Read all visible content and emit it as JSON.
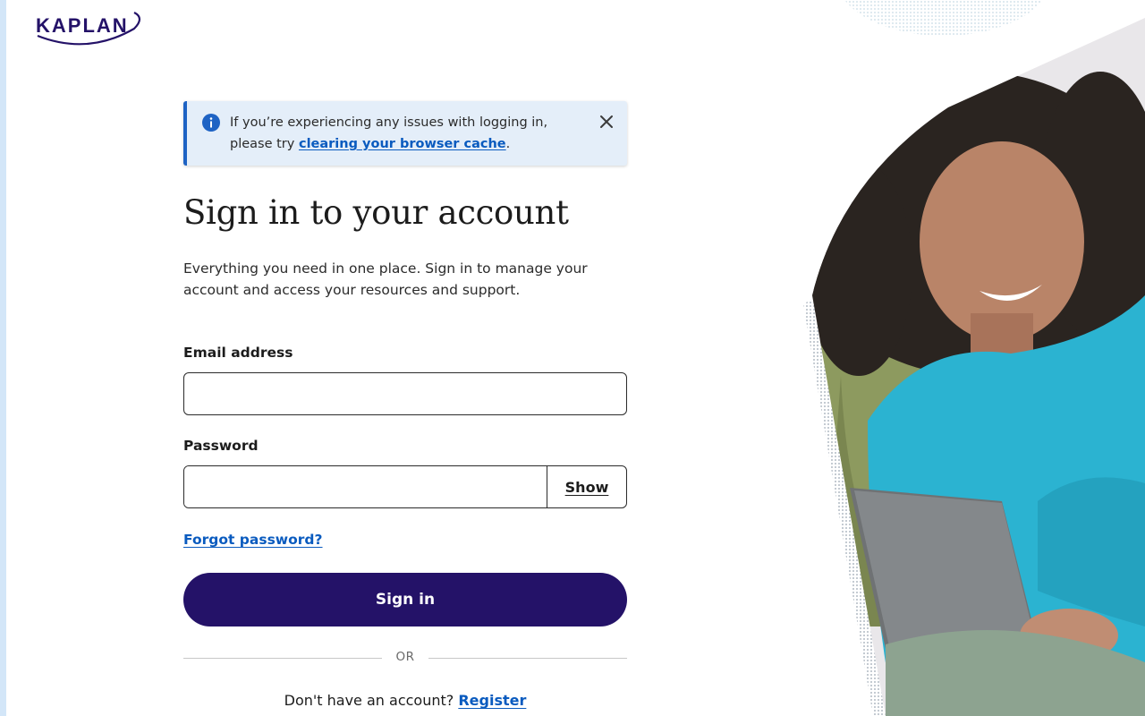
{
  "brand": {
    "logo_text": "KAPLAN"
  },
  "alert": {
    "text_before": "If you’re experiencing any issues with logging in, please try ",
    "link_text": "clearing your browser cache",
    "text_after": ".",
    "icon": "info-icon",
    "close_icon": "close-icon"
  },
  "page": {
    "title": "Sign in to your account",
    "subtitle": "Everything you need in one place. Sign in to manage your account and access your resources and support."
  },
  "form": {
    "email_label": "Email address",
    "email_value": "",
    "password_label": "Password",
    "password_value": "",
    "show_label": "Show",
    "forgot_label": "Forgot password?",
    "submit_label": "Sign in",
    "divider_label": "OR",
    "register_prompt": "Don't have an account? ",
    "register_label": "Register"
  },
  "colors": {
    "brand_navy": "#241268",
    "link_blue": "#0a5bbf",
    "alert_bg": "#e4eef9",
    "alert_border": "#1e63c4",
    "sweater_teal": "#2bb3d1"
  }
}
